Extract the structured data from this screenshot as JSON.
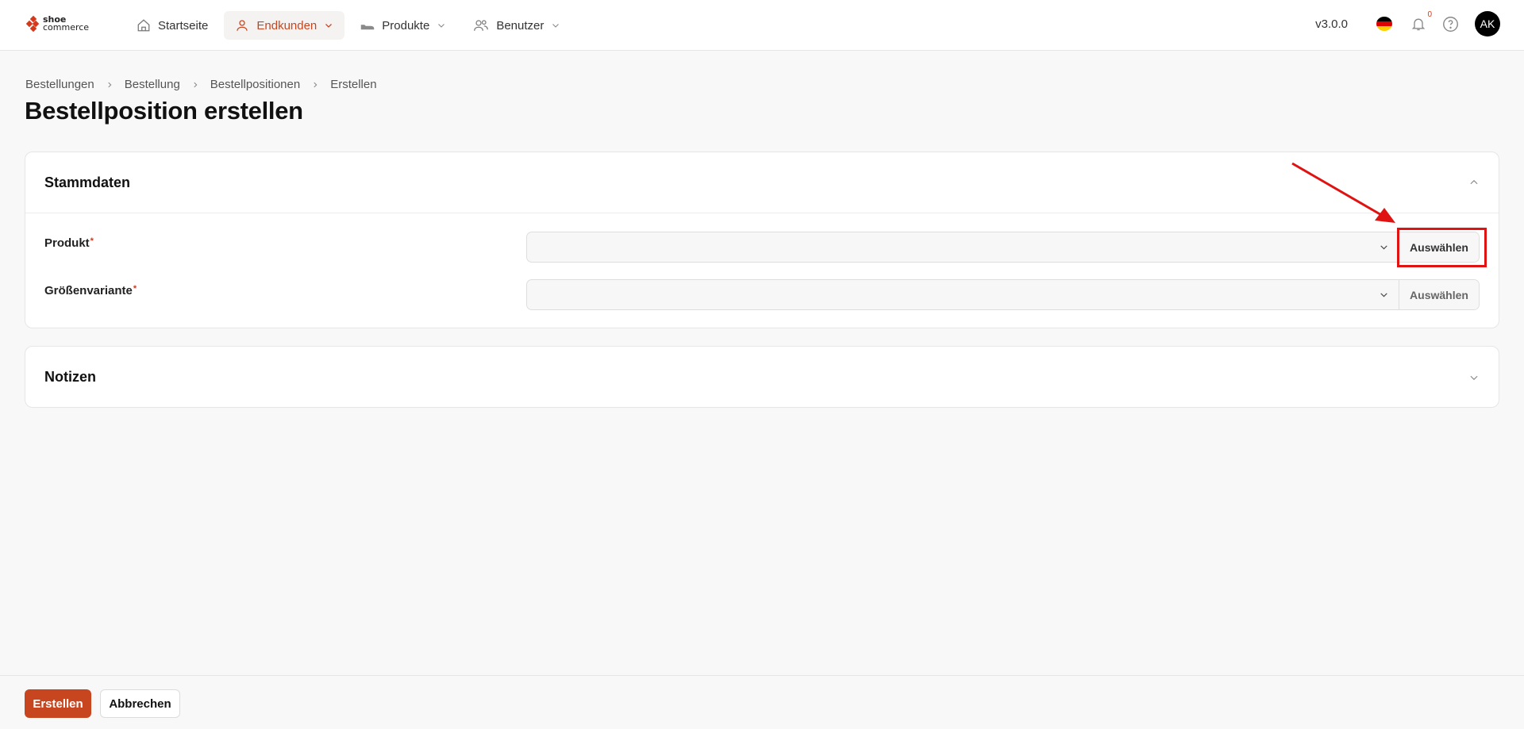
{
  "brand": {
    "line1": "shoe",
    "line2": "commerce",
    "color": "#d4391b"
  },
  "nav": {
    "items": [
      {
        "label": "Startseite",
        "icon": "home-icon"
      },
      {
        "label": "Endkunden",
        "icon": "user-icon",
        "active": true
      },
      {
        "label": "Produkte",
        "icon": "shoe-icon"
      },
      {
        "label": "Benutzer",
        "icon": "users-icon"
      }
    ]
  },
  "header": {
    "version": "v3.0.0",
    "language_flag": "germany-flag-icon",
    "notifications_count": "0",
    "avatar_initials": "AK"
  },
  "breadcrumb": [
    "Bestellungen",
    "Bestellung",
    "Bestellpositionen",
    "Erstellen"
  ],
  "page": {
    "title": "Bestellposition erstellen"
  },
  "sections": {
    "master": {
      "title": "Stammdaten",
      "fields": [
        {
          "label": "Produkt",
          "required_mark": "*",
          "value": "",
          "button": "Auswählen"
        },
        {
          "label": "Größenvariante",
          "required_mark": "*",
          "value": "",
          "button": "Auswählen"
        }
      ]
    },
    "notes": {
      "title": "Notizen"
    }
  },
  "footer": {
    "create_label": "Erstellen",
    "cancel_label": "Abbrechen"
  },
  "colors": {
    "accent": "#c8461f",
    "highlight": "#e01313"
  }
}
